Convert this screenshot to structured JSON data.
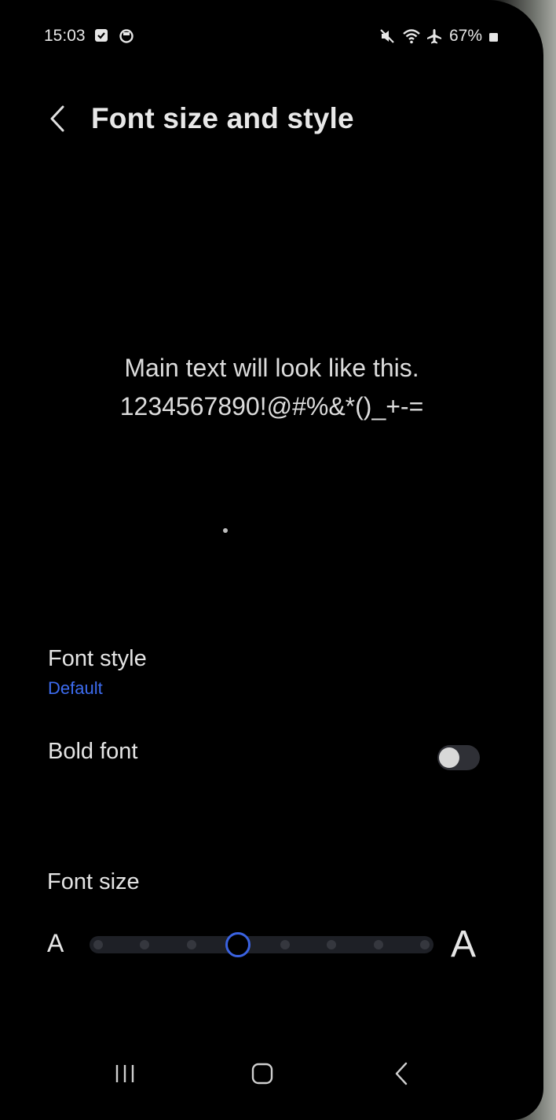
{
  "status_bar": {
    "time": "15:03",
    "left_icons": [
      "checkbox-notification-icon",
      "alarm-icon"
    ],
    "right_icons": [
      "mute-icon",
      "wifi-icon",
      "airplane-icon"
    ],
    "battery_percent": "67%"
  },
  "header": {
    "back_icon": "chevron-left-icon",
    "title": "Font size and style"
  },
  "preview": {
    "line1": "Main text will look like this.",
    "line2": "1234567890!@#%&*()_+-="
  },
  "font_style": {
    "label": "Font style",
    "value": "Default",
    "value_color": "#3d6cf0"
  },
  "bold_font": {
    "label": "Bold font",
    "enabled": false
  },
  "font_size": {
    "label": "Font size",
    "small_glyph": "A",
    "large_glyph": "A",
    "steps": 8,
    "selected_step_index": 3,
    "accent_color": "#3a62e0"
  },
  "nav_bar": {
    "icons": [
      "recent-apps-icon",
      "home-icon",
      "back-icon"
    ]
  }
}
